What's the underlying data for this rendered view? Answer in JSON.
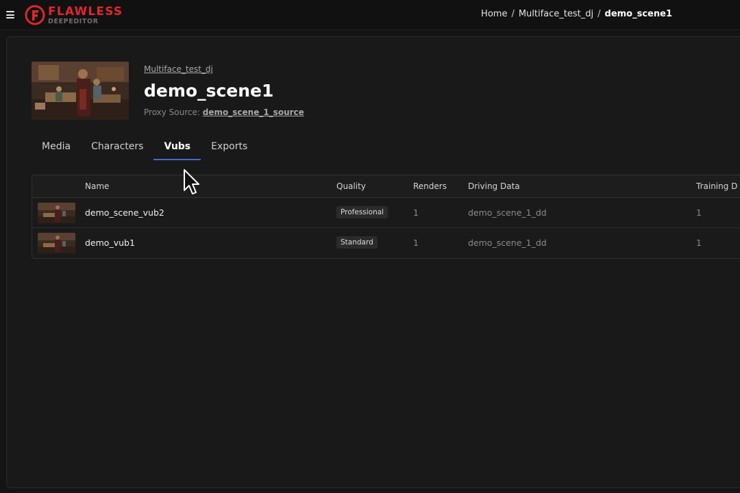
{
  "topbar": {
    "menu_icon": "hamburger-menu-icon",
    "logo": {
      "main": "FLAWLESS",
      "sub": "DEEPEDITOR",
      "color": "#e0262d"
    },
    "breadcrumb": {
      "home": "Home",
      "project": "Multiface_test_dj",
      "current": "demo_scene1",
      "separator": "/"
    }
  },
  "header": {
    "project_link": "Multiface_test_dj",
    "title": "demo_scene1",
    "proxy_label": "Proxy Source:",
    "proxy_value": "demo_scene_1_source"
  },
  "tabs": [
    {
      "label": "Media",
      "active": false
    },
    {
      "label": "Characters",
      "active": false
    },
    {
      "label": "Vubs",
      "active": true
    },
    {
      "label": "Exports",
      "active": false
    }
  ],
  "table": {
    "columns": [
      "Name",
      "Quality",
      "Renders",
      "Driving Data",
      "Training D"
    ],
    "rows": [
      {
        "name": "demo_scene_vub2",
        "quality": "Professional",
        "renders": "1",
        "driving_data": "demo_scene_1_dd",
        "training": "1"
      },
      {
        "name": "demo_vub1",
        "quality": "Standard",
        "renders": "1",
        "driving_data": "demo_scene_1_dd",
        "training": "1"
      }
    ]
  },
  "colors": {
    "accent": "#4a67d6",
    "background": "#141414",
    "panel": "#191919"
  }
}
